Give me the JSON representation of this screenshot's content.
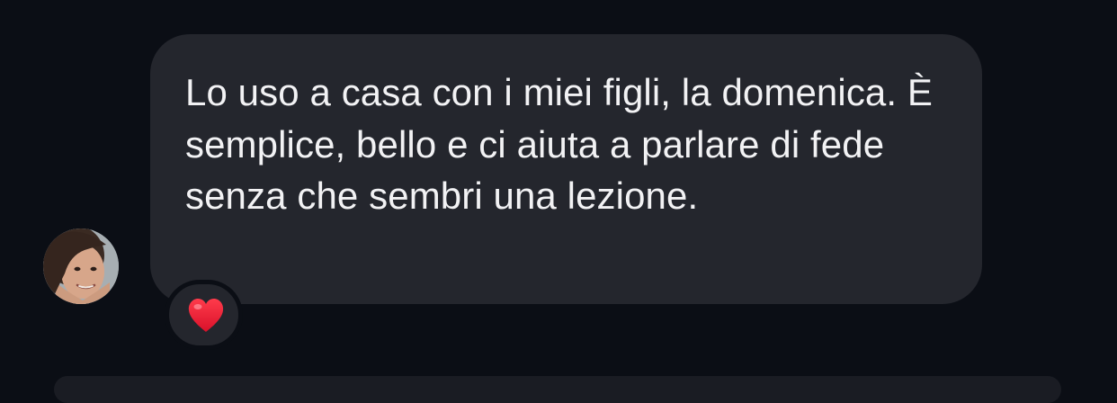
{
  "message": {
    "text": "Lo uso a casa con i miei figli, la domenica. È semplice, bello e ci aiuta a parlare di fede senza che sembri una lezione.",
    "sender_avatar": "user-avatar-photo"
  },
  "reaction": {
    "icon": "red-heart-icon",
    "emoji": "❤️"
  },
  "colors": {
    "background": "#0b0e15",
    "bubble": "#24262d",
    "text": "#f2f2f4",
    "heart": "#e3172e"
  }
}
